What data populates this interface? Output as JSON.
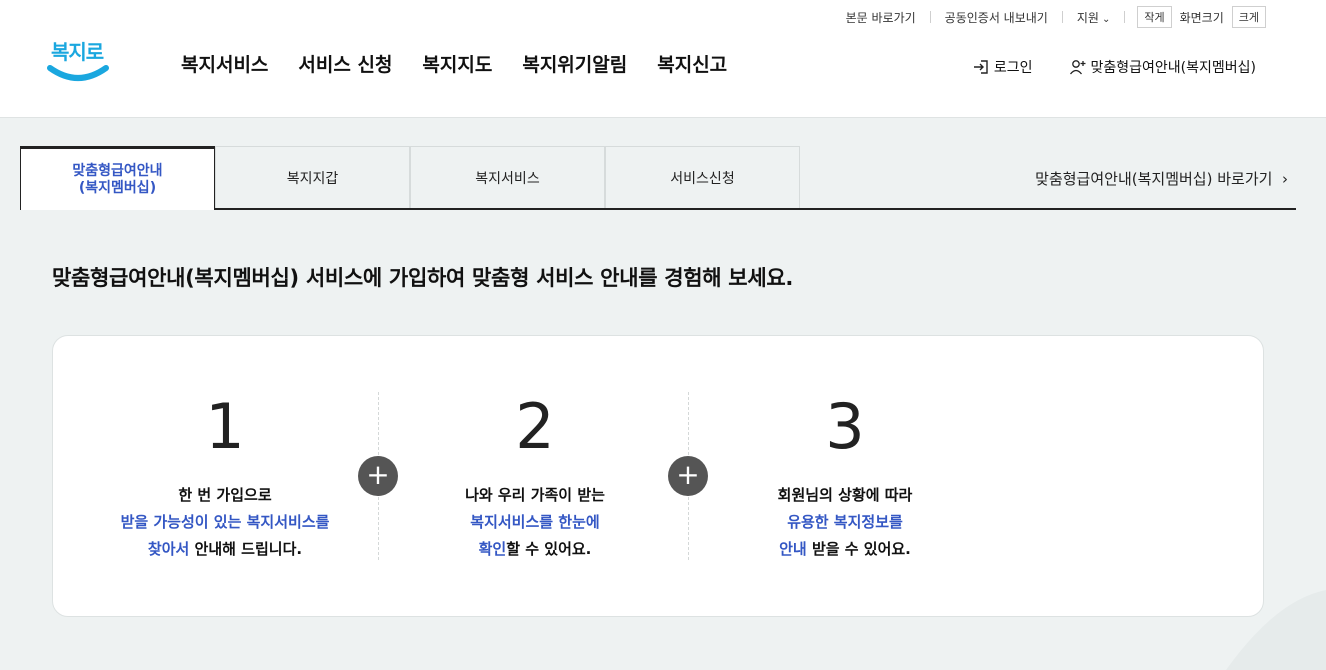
{
  "utility": {
    "skip_to_content": "본문 바로가기",
    "cert_export": "공동인증서 내보내기",
    "support": "지원",
    "font_small": "작게",
    "font_size_label": "화면크기",
    "font_large": "크게"
  },
  "logo": {
    "text": "복지로"
  },
  "gnb": [
    "복지서비스",
    "서비스 신청",
    "복지지도",
    "복지위기알림",
    "복지신고"
  ],
  "member": {
    "login": "로그인",
    "membership": "맞춤형급여안내(복지멤버십)"
  },
  "tabs": [
    {
      "line1": "맞춤형급여안내",
      "line2": "(복지멤버십)"
    },
    {
      "line1": "복지지갑",
      "line2": ""
    },
    {
      "line1": "복지서비스",
      "line2": ""
    },
    {
      "line1": "서비스신청",
      "line2": ""
    }
  ],
  "tab_shortcut": "맞춤형급여안내(복지멤버십) 바로가기",
  "intro_title": "맞춤형급여안내(복지멤버십) 서비스에 가입하여 맞춤형 서비스 안내를 경험해 보세요.",
  "steps": [
    {
      "num": "1",
      "l1": "한 번 가입으로",
      "l2_hl": "받을 가능성이 있는 복지서비스를",
      "l3_hl": "찾아서",
      "l3": " 안내해 드립니다."
    },
    {
      "num": "2",
      "l1": "나와 우리 가족이 받는",
      "l2_hl": "복지서비스를 한눈에",
      "l3_hl": "확인",
      "l3": "할 수 있어요."
    },
    {
      "num": "3",
      "l1": "회원님의 상황에 따라",
      "l2_hl": "유용한 복지정보를",
      "l3_hl": "안내",
      "l3": " 받을 수 있어요."
    }
  ],
  "plus_symbol": "+",
  "colors": {
    "accent": "#3457c4",
    "logo": "#1aa7df",
    "background": "#eef2f2"
  }
}
